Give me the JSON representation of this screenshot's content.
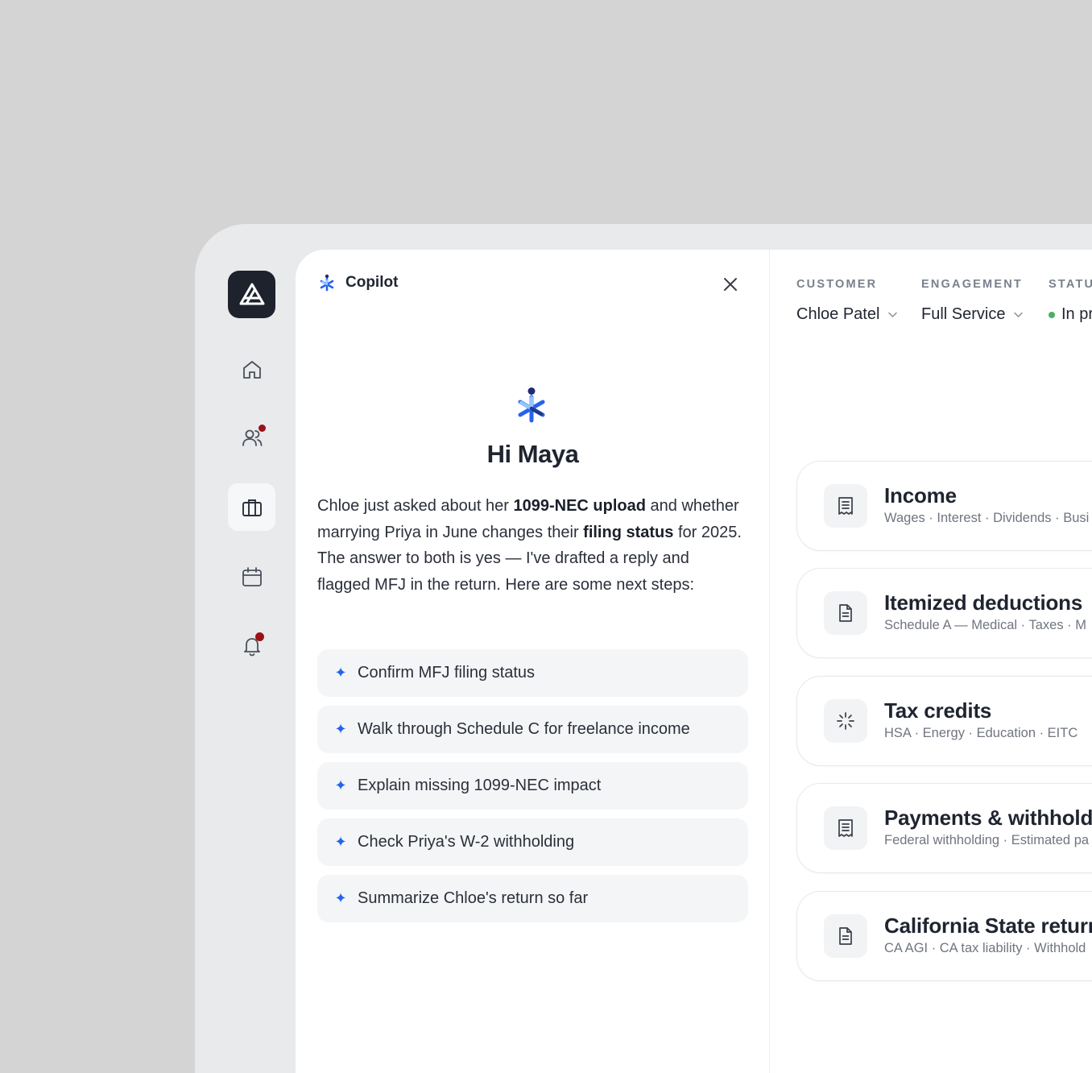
{
  "sidebar": {
    "logo": "brand-logo",
    "items": [
      {
        "icon": "home-icon"
      },
      {
        "icon": "users-icon",
        "badge": true
      },
      {
        "icon": "briefcase-icon",
        "active": true
      },
      {
        "icon": "calendar-icon"
      },
      {
        "icon": "bell-icon",
        "badge": true
      }
    ]
  },
  "copilot": {
    "title": "Copilot",
    "greeting": "Hi Maya",
    "message": {
      "p1": "Chloe just asked about her ",
      "b1": "1099-NEC upload",
      "p2": " and whether marrying Priya in June changes their ",
      "b2": "filing status",
      "p3": " for 2025. The answer to both is yes — I've drafted a reply and flagged MFJ in the return. Here are some next steps:"
    },
    "suggestions": [
      "Confirm MFJ filing status",
      "Walk through Schedule C for freelance income",
      "Explain missing 1099-NEC impact",
      "Check Priya's W-2 withholding",
      "Summarize Chloe's return so far"
    ]
  },
  "header": {
    "customer_label": "CUSTOMER",
    "customer_value": "Chloe Patel",
    "engagement_label": "ENGAGEMENT",
    "engagement_value": "Full Service",
    "status_label": "STATU",
    "status_value": "In pr"
  },
  "sections": [
    {
      "title": "Income",
      "subtitle": "Wages · Interest · Dividends · Busi",
      "icon": "receipt-icon"
    },
    {
      "title": "Itemized deductions",
      "subtitle": "Schedule A — Medical · Taxes · M",
      "icon": "document-icon"
    },
    {
      "title": "Tax credits",
      "subtitle": "HSA · Energy · Education · EITC",
      "icon": "sparkle-icon"
    },
    {
      "title": "Payments & withholdir",
      "subtitle": "Federal withholding · Estimated pa",
      "icon": "receipt-icon"
    },
    {
      "title": "California State return",
      "subtitle": "CA AGI · CA tax liability · Withhold",
      "icon": "document-icon"
    }
  ],
  "colors": {
    "accent": "#2563eb",
    "badge": "#9b1118",
    "status": "#4caf67"
  }
}
